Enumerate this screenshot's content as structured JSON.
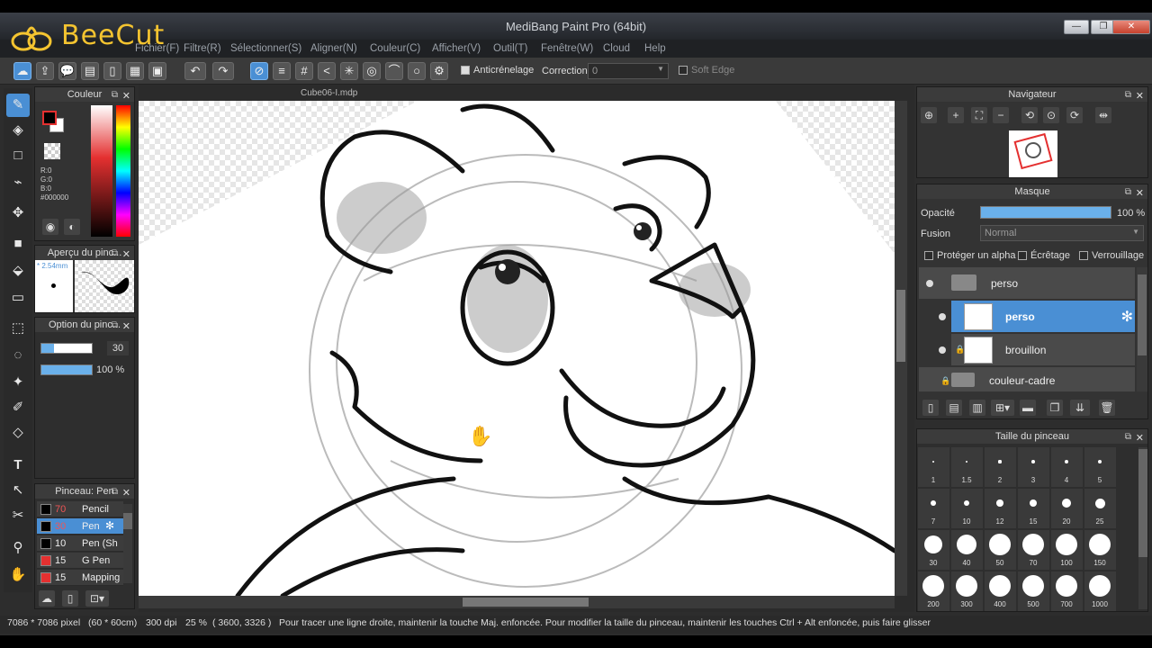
{
  "watermark": {
    "brand": "BeeCut"
  },
  "window": {
    "title": "MediBang Paint Pro (64bit)"
  },
  "menu": [
    "Fichier(F)",
    "Filtre(R)",
    "Sélectionner(S)",
    "Aligner(N)",
    "Couleur(C)",
    "Afficher(V)",
    "Outil(T)",
    "Fenêtre(W)",
    "Cloud",
    "Help"
  ],
  "toolbar": {
    "antialias_label": "Anticrénelage",
    "correction_label": "Correction",
    "correction_value": "0",
    "soft_edge_label": "Soft Edge"
  },
  "document": {
    "tab_name": "Cube06-I.mdp"
  },
  "color_panel": {
    "title": "Couleur",
    "r": "R:0",
    "g": "G:0",
    "b": "B:0",
    "hex": "#000000",
    "fg_color": "#000000",
    "bg_color": "#ffffff"
  },
  "brush_preview": {
    "title": "Aperçu du pinc...",
    "size": "2.54mm"
  },
  "brush_option": {
    "title": "Option du pinc...",
    "size_value": "30",
    "opacity_value": "100 %",
    "size_fraction": 0.25,
    "opacity_fraction": 1.0
  },
  "brush_list": {
    "title": "Pinceau: Pen",
    "items": [
      {
        "size": "70",
        "name": "Pencil",
        "color": "#000000",
        "size_color": "#e55"
      },
      {
        "size": "30",
        "name": "Pen",
        "color": "#000000",
        "size_color": "#e55"
      },
      {
        "size": "10",
        "name": "Pen (Sh",
        "color": "#000000",
        "size_color": "#eee"
      },
      {
        "size": "15",
        "name": "G Pen",
        "color": "#e43030",
        "size_color": "#eee"
      },
      {
        "size": "15",
        "name": "Mapping",
        "color": "#e43030",
        "size_color": "#eee"
      }
    ]
  },
  "navigator": {
    "title": "Navigateur"
  },
  "layer_panel": {
    "title": "Masque",
    "opacity_label": "Opacité",
    "opacity_value": "100 %",
    "opacity_fraction": 1.0,
    "blend_label": "Fusion",
    "blend_value": "Normal",
    "protect_alpha": "Protéger un alpha",
    "clipping": "Écrêtage",
    "lock": "Verrouillage",
    "layers": [
      {
        "name": "perso",
        "type": "folder"
      },
      {
        "name": "perso",
        "type": "layer",
        "selected": true
      },
      {
        "name": "brouillon",
        "type": "layer"
      },
      {
        "name": "couleur-cadre",
        "type": "folder"
      }
    ]
  },
  "brush_size_panel": {
    "title": "Taille du pinceau",
    "sizes": [
      "1",
      "1.5",
      "2",
      "3",
      "4",
      "5",
      "7",
      "10",
      "12",
      "15",
      "20",
      "25",
      "30",
      "40",
      "50",
      "70",
      "100",
      "150",
      "200",
      "300",
      "400",
      "500",
      "700",
      "1000"
    ]
  },
  "status": {
    "dimensions": "7086 * 7086 pixel",
    "physical": "(60 * 60cm)",
    "dpi": "300 dpi",
    "zoom": "25 %",
    "coords": "( 3600, 3326 )",
    "hint": "Pour tracer une ligne droite, maintenir la touche Maj. enfoncée. Pour modifier la taille du pinceau, maintenir les touches Ctrl + Alt enfoncée, puis faire glisser"
  }
}
